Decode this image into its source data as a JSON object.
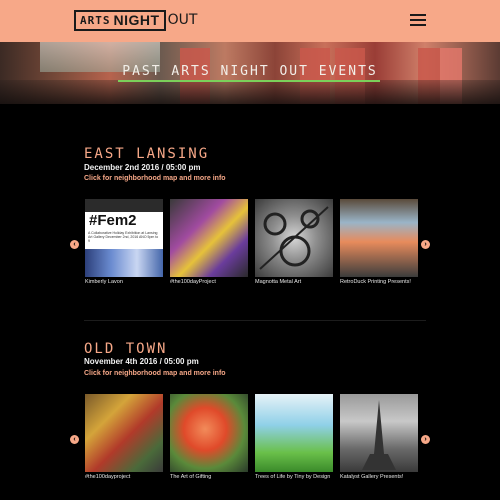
{
  "header": {
    "logo_arts": "ARTS",
    "logo_night": "NIGHT",
    "logo_out": "OUT",
    "menu_icon": "hamburger-menu-icon",
    "background_color": "#f7a888"
  },
  "hero": {
    "title": "PAST ARTS NIGHT OUT EVENTS",
    "underline_color": "#7bd05a"
  },
  "accent_color": "#f7a888",
  "sections": [
    {
      "name": "EAST LANSING",
      "date": "December 2nd 2016 / 05:00 pm",
      "link": "Click for neighborhood map and more info",
      "prev_icon": "chevron-left-icon",
      "next_icon": "chevron-right-icon",
      "cards": [
        {
          "label": "Kimberly Lavon",
          "image_text": "#Fem2",
          "image_caption": "A Collaborative Holiday Exhibition at Lansing Art Gallery December 2nd, 2016 ANO 5pm to 9"
        },
        {
          "label": "#the100dayProject"
        },
        {
          "label": "Magnotta Metal Art"
        },
        {
          "label": "RetroDuck Printing Presents!"
        }
      ]
    },
    {
      "name": "OLD TOWN",
      "date": "November 4th 2016 / 05:00 pm",
      "link": "Click for neighborhood map and more info",
      "prev_icon": "chevron-left-icon",
      "next_icon": "chevron-right-icon",
      "cards": [
        {
          "label": "#the100dayproject"
        },
        {
          "label": "The Art of Gifting"
        },
        {
          "label": "Trees of Life by Tiny by Design"
        },
        {
          "label": "Katalyst Gallery Presents!"
        }
      ]
    }
  ]
}
